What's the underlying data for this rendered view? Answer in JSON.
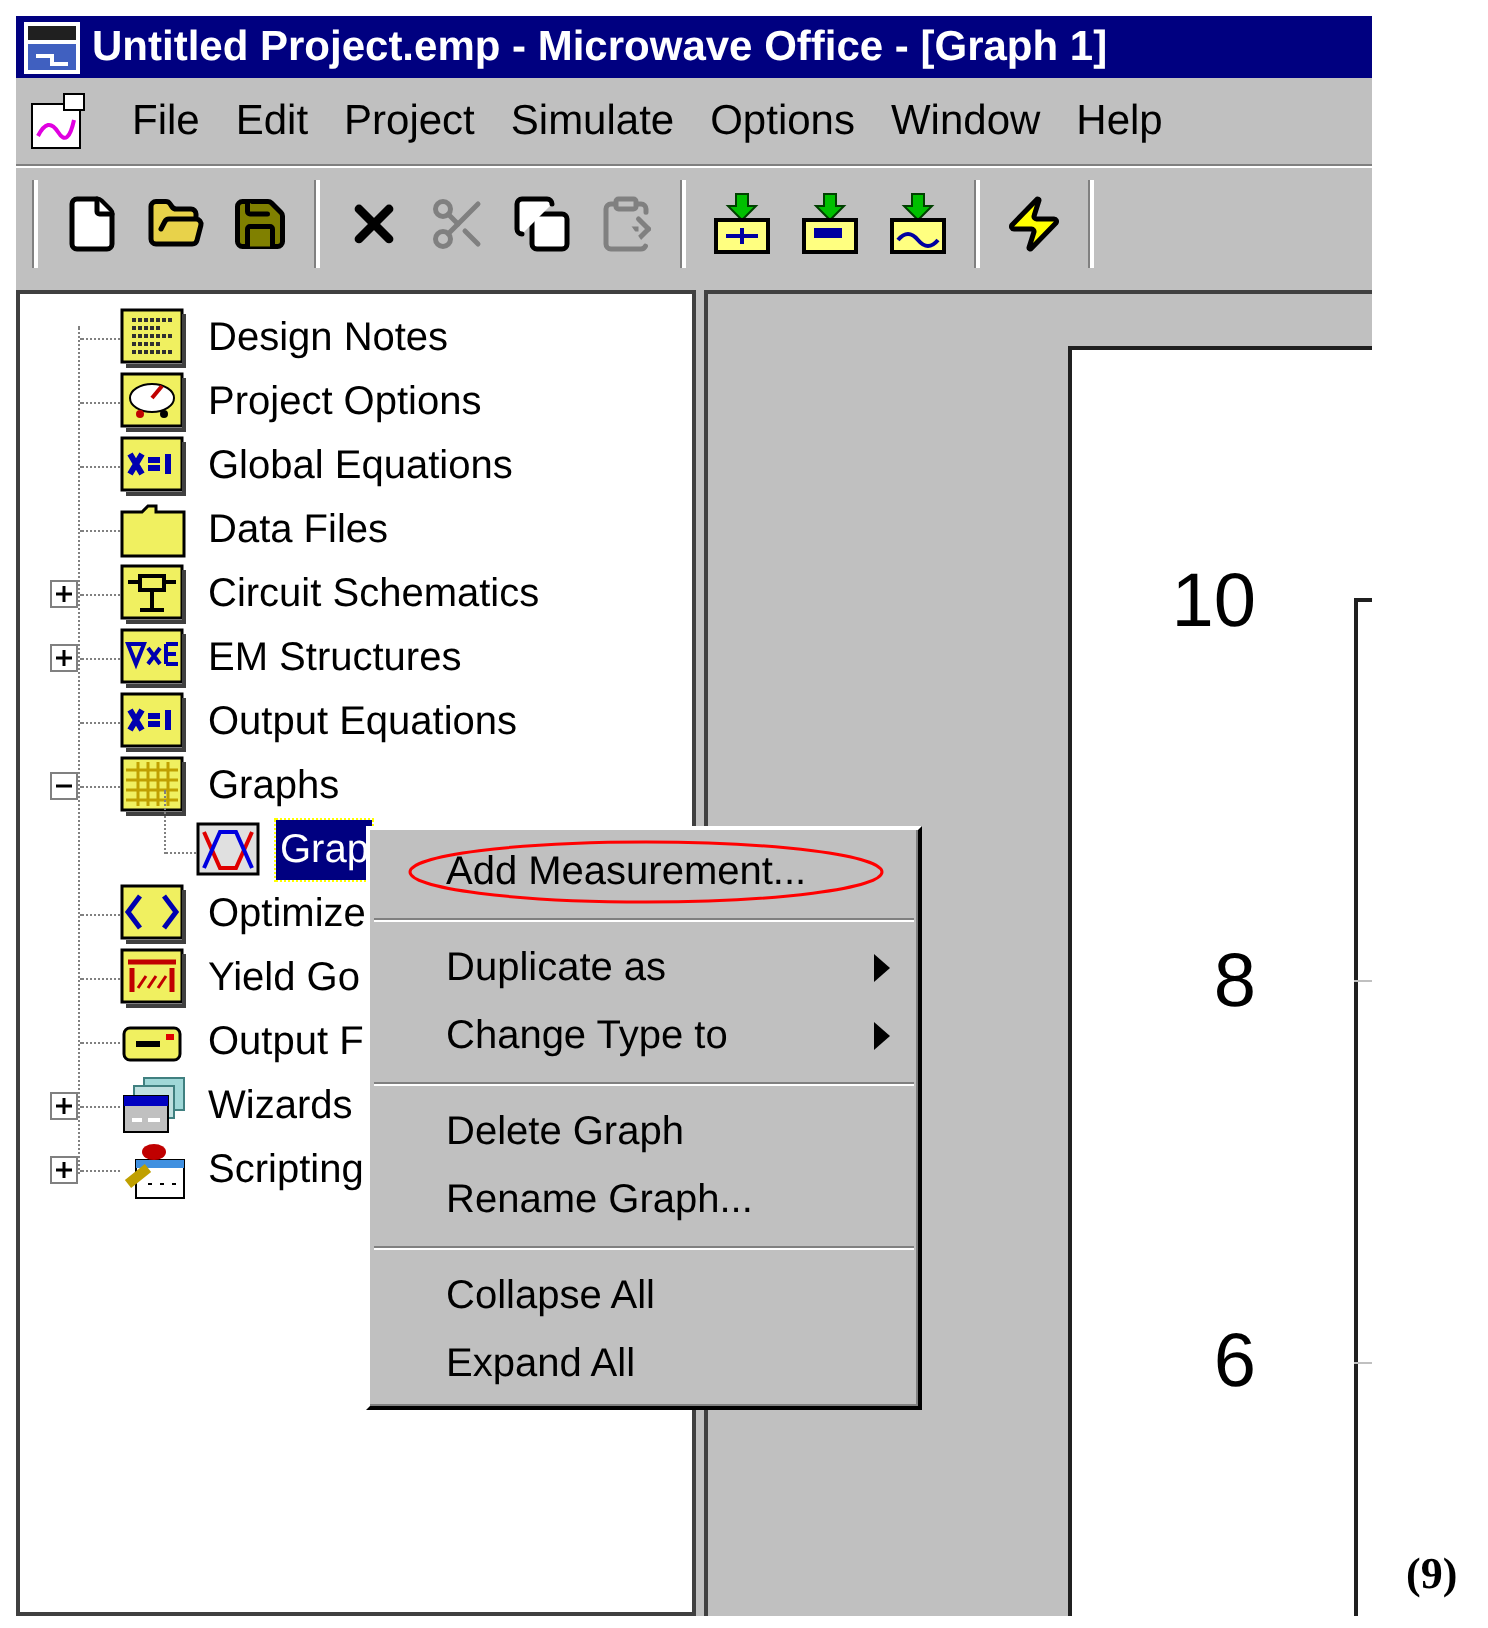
{
  "window": {
    "title": "Untitled Project.emp - Microwave Office - [Graph 1]"
  },
  "menu_bar": [
    "File",
    "Edit",
    "Project",
    "Simulate",
    "Options",
    "Window",
    "Help"
  ],
  "toolbar": [
    {
      "kind": "new",
      "disabled": false
    },
    {
      "kind": "open",
      "disabled": false
    },
    {
      "kind": "save",
      "disabled": false
    },
    {
      "kind": "sep"
    },
    {
      "kind": "delete",
      "disabled": false
    },
    {
      "kind": "cut",
      "disabled": true
    },
    {
      "kind": "copy",
      "disabled": false
    },
    {
      "kind": "paste",
      "disabled": true
    },
    {
      "kind": "sep"
    },
    {
      "kind": "add-schematic",
      "disabled": false
    },
    {
      "kind": "add-em",
      "disabled": false
    },
    {
      "kind": "add-graph",
      "disabled": false
    },
    {
      "kind": "sep"
    },
    {
      "kind": "simulate",
      "disabled": false
    },
    {
      "kind": "sep"
    }
  ],
  "tree": [
    {
      "label": "Design Notes",
      "kind": "notes"
    },
    {
      "label": "Project Options",
      "kind": "options"
    },
    {
      "label": "Global Equations",
      "kind": "equation"
    },
    {
      "label": "Data Files",
      "kind": "folder"
    },
    {
      "label": "Circuit Schematics",
      "kind": "schematic",
      "expanded": false
    },
    {
      "label": "EM Structures",
      "kind": "em",
      "expanded": false
    },
    {
      "label": "Output Equations",
      "kind": "equation"
    },
    {
      "label": "Graphs",
      "kind": "grid",
      "expanded": true,
      "children": [
        {
          "label": "Grap",
          "kind": "graph",
          "selected": true
        }
      ]
    },
    {
      "label": "Optimize",
      "kind": "optimize"
    },
    {
      "label": "Yield Go",
      "kind": "yield"
    },
    {
      "label": "Output F",
      "kind": "output"
    },
    {
      "label": "Wizards",
      "kind": "wizard",
      "expanded": false
    },
    {
      "label": "Scripting",
      "kind": "script",
      "expanded": false
    }
  ],
  "context_menu": [
    {
      "kind": "item",
      "label": "Add Measurement...",
      "circled": true
    },
    {
      "kind": "separator"
    },
    {
      "kind": "submenu",
      "label": "Duplicate as"
    },
    {
      "kind": "submenu",
      "label": "Change Type to"
    },
    {
      "kind": "separator"
    },
    {
      "kind": "item",
      "label": "Delete Graph",
      "circled": false
    },
    {
      "kind": "item",
      "label": "Rename Graph...",
      "circled": false
    },
    {
      "kind": "separator"
    },
    {
      "kind": "item",
      "label": "Collapse All",
      "circled": false
    },
    {
      "kind": "item",
      "label": "Expand All",
      "circled": false
    }
  ],
  "graph": {
    "y_labels": [
      "10",
      "8",
      "6"
    ]
  },
  "figure_number": "(9)"
}
